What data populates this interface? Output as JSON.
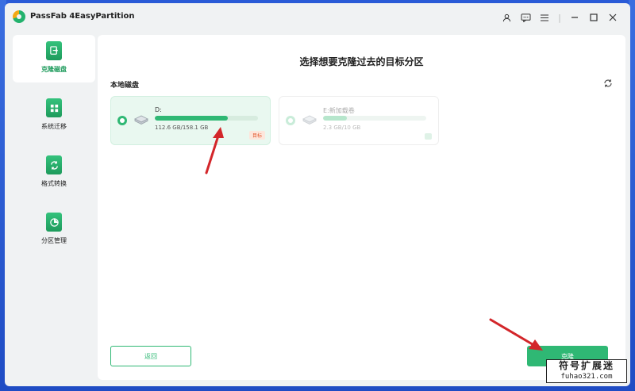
{
  "window": {
    "title": "PassFab 4EasyPartition"
  },
  "titlebar_icons": [
    "user-icon",
    "feedback-icon",
    "menu-icon",
    "minimize-icon",
    "maximize-icon",
    "close-icon"
  ],
  "sidebar": {
    "items": [
      {
        "label": "克隆磁盘",
        "icon": "clone-disk-icon",
        "active": true
      },
      {
        "label": "系统迁移",
        "icon": "system-migration-icon",
        "active": false
      },
      {
        "label": "格式转换",
        "icon": "format-convert-icon",
        "active": false
      },
      {
        "label": "分区管理",
        "icon": "partition-manage-icon",
        "active": false
      }
    ]
  },
  "main": {
    "title": "选择想要克隆过去的目标分区",
    "section_label": "本地磁盘",
    "disks": [
      {
        "name": "D:",
        "size": "112.6 GB/158.1 GB",
        "used_fraction": 0.71,
        "badge": "目标",
        "selected": true
      },
      {
        "name": "E:新加载卷",
        "size": "2.3 GB/10 GB",
        "used_fraction": 0.23,
        "badge": "",
        "selected": false
      }
    ],
    "back_label": "返回",
    "start_label": "克隆"
  },
  "watermark": {
    "line1": "符号扩展迷",
    "line2": "fuhao321.com"
  },
  "colors": {
    "accent": "#2fb874",
    "badge": "#e2572b",
    "arrow": "#d3262a"
  }
}
